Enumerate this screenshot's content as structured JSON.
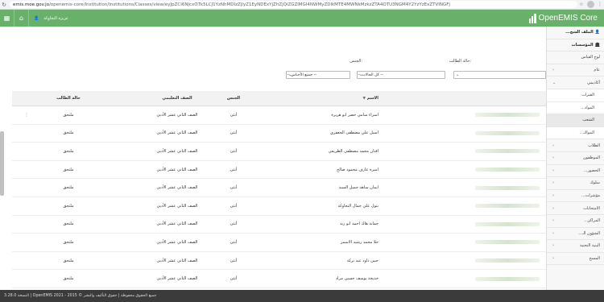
{
  "browser": {
    "url_host": "emis.moe.gov.jo",
    "url_path": "/openemis-core/Institution/Institutions/Classes/view/eyJpZCI6NjcxOTk5LCJ1YzNhMDIzZjlyZ1EyNDExYjZhZjQiZGZlMGI4NWMyZDlkMTE4MWNkMzkzZTA4OTU3NGM4Y2YzYzExZTVINGFj"
  },
  "header": {
    "user_name": "عزيزه النجاوكة",
    "logo_text": "OpenEMIS Core"
  },
  "sidebar": {
    "items": [
      {
        "label": "الملف الشخ...",
        "level": "top",
        "icon": "user-icon"
      },
      {
        "label": "المؤسسات",
        "level": "top",
        "icon": "institution-icon"
      },
      {
        "label": "لوح القياس",
        "level": "sub"
      },
      {
        "label": "عام",
        "level": "sub",
        "arrow": "‹"
      },
      {
        "label": "أكاديمي",
        "level": "sub",
        "arrow": "⌄"
      },
      {
        "label": "الفترات",
        "level": "sub2"
      },
      {
        "label": "المواد...",
        "level": "sub2"
      },
      {
        "label": "الشعب",
        "level": "sub2",
        "active": true
      },
      {
        "label": "المواك...",
        "level": "sub2"
      },
      {
        "label": "الطلاب",
        "level": "sub",
        "arrow": "‹"
      },
      {
        "label": "الموظفون",
        "level": "sub",
        "arrow": "‹"
      },
      {
        "label": "الحضور...",
        "level": "sub",
        "arrow": "‹"
      },
      {
        "label": "سلوك",
        "level": "sub",
        "arrow": "‹"
      },
      {
        "label": "مؤشرات...",
        "level": "sub",
        "arrow": "‹"
      },
      {
        "label": "الامتحانات",
        "level": "sub",
        "arrow": "‹"
      },
      {
        "label": "المراكز...",
        "level": "sub",
        "arrow": "‹"
      },
      {
        "label": "الشؤون الـ...",
        "level": "sub",
        "arrow": "‹"
      },
      {
        "label": "البنية التحتية",
        "level": "sub",
        "arrow": "‹"
      },
      {
        "label": "المسح",
        "level": "sub",
        "arrow": "‹"
      }
    ]
  },
  "filters": {
    "status_label": "حالة الطالب:",
    "status_value": "-- كل الحالات --",
    "gender_label": "الجنس:",
    "gender_value": "-- جميع الأجناس --"
  },
  "table": {
    "headers": {
      "name": "الاسم",
      "gender": "الجنس",
      "grade": "الصف التعليمي",
      "status": "حالة الطالب"
    },
    "rows": [
      {
        "name": "اسراء سامي خضر ابو هريرة",
        "gender": "أنثى",
        "grade": "الصف الثاني عشر الأدبي",
        "status": "ملتحق"
      },
      {
        "name": "اسيل علي مصطفى الجعفري",
        "gender": "أنثى",
        "grade": "الصف الثاني عشر الأدبي",
        "status": "ملتحق"
      },
      {
        "name": "افنان محمد مصطفى الطريفي",
        "gender": "أنثى",
        "grade": "الصف الثاني عشر الأدبي",
        "status": "ملتحق"
      },
      {
        "name": "اميرة عارف محمود صالح",
        "gender": "أنثى",
        "grade": "الصف الثاني عشر الأدبي",
        "status": "ملتحق"
      },
      {
        "name": "ايمان ساهد جميل السيد",
        "gender": "أنثى",
        "grade": "الصف الثاني عشر الأدبي",
        "status": "ملتحق"
      },
      {
        "name": "بتول علي جمال النجاوكة",
        "gender": "أنثى",
        "grade": "الصف الثاني عشر الأدبي",
        "status": "ملتحق"
      },
      {
        "name": "جمانة هاك احمد ابو زيد",
        "gender": "أنثى",
        "grade": "الصف الثاني عشر الأدبي",
        "status": "ملتحق"
      },
      {
        "name": "حلا محمد رشيد الاسمر",
        "gender": "أنثى",
        "grade": "الصف الثاني عشر الأدبي",
        "status": "ملتحق"
      },
      {
        "name": "حنين داود عبد بركة",
        "gender": "أنثى",
        "grade": "الصف الثاني عشر الأدبي",
        "status": "ملتحق"
      },
      {
        "name": "خديجة يوسف حسين مراد",
        "gender": "أنثى",
        "grade": "الصف الثاني عشر الأدبي",
        "status": "ملتحق"
      },
      {
        "name": "دانية ابراهيم يحيى دحسان",
        "gender": "أنثى",
        "grade": "الصف الثاني عشر الأدبي",
        "status": "ملتحق"
      }
    ]
  },
  "footer": {
    "text": "3.28.0 النسخة | OpenEMIS 2021 - 2015 © جميع الحقوق محفوظة | حقوق التأليف والنشر"
  }
}
